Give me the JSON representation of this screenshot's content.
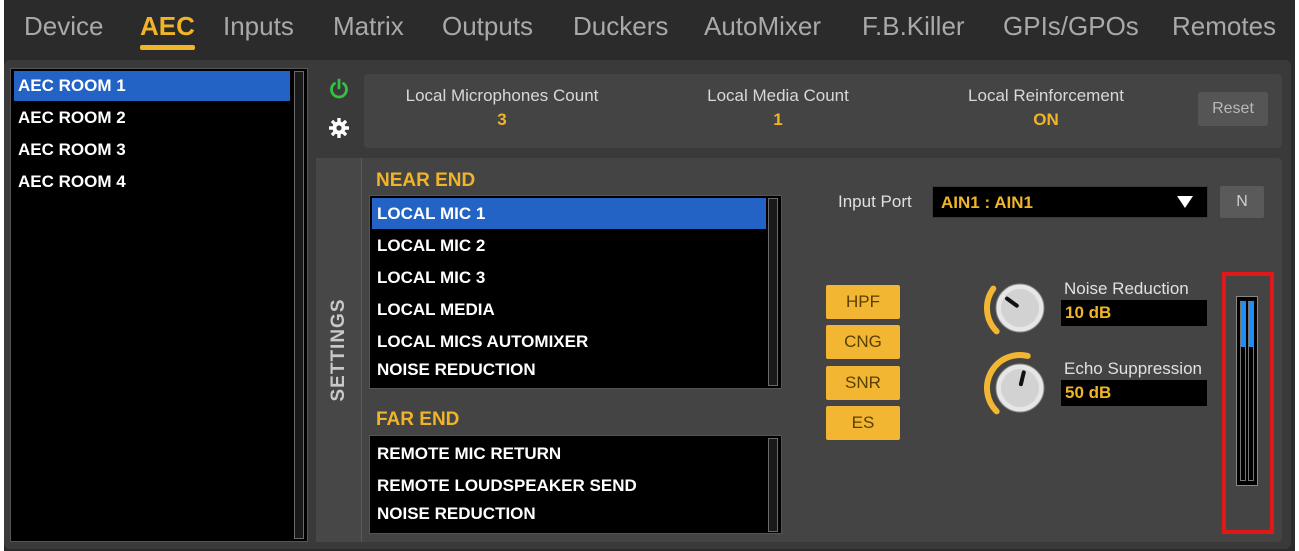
{
  "tabs": [
    {
      "label": "Device",
      "active": false
    },
    {
      "label": "AEC",
      "active": true
    },
    {
      "label": "Inputs",
      "active": false
    },
    {
      "label": "Matrix",
      "active": false
    },
    {
      "label": "Outputs",
      "active": false
    },
    {
      "label": "Duckers",
      "active": false
    },
    {
      "label": "AutoMixer",
      "active": false
    },
    {
      "label": "F.B.Killer",
      "active": false
    },
    {
      "label": "GPIs/GPOs",
      "active": false
    },
    {
      "label": "Remotes",
      "active": false
    }
  ],
  "rooms": {
    "items": [
      "AEC ROOM 1",
      "AEC ROOM 2",
      "AEC ROOM 3",
      "AEC ROOM 4"
    ],
    "selected_index": 0
  },
  "header": {
    "power_icon": "power-icon",
    "gear_icon": "gear-icon",
    "stats": [
      {
        "label": "Local Microphones Count",
        "value": "3"
      },
      {
        "label": "Local Media Count",
        "value": "1"
      },
      {
        "label": "Local Reinforcement",
        "value": "ON"
      }
    ],
    "reset_label": "Reset"
  },
  "settings": {
    "tab_label": "SETTINGS",
    "near_end": {
      "title": "NEAR END",
      "items": [
        "LOCAL MIC 1",
        "LOCAL MIC 2",
        "LOCAL MIC 3",
        "LOCAL MEDIA",
        "LOCAL MICS AUTOMIXER",
        "NOISE REDUCTION"
      ],
      "selected_index": 0
    },
    "far_end": {
      "title": "FAR END",
      "items": [
        "REMOTE MIC RETURN",
        "REMOTE LOUDSPEAKER SEND",
        "NOISE REDUCTION"
      ]
    },
    "input_port": {
      "label": "Input Port",
      "value": "AIN1 : AIN1",
      "n_label": "N"
    },
    "fx_buttons": [
      "HPF",
      "CNG",
      "SNR",
      "ES"
    ],
    "noise_reduction": {
      "label": "Noise Reduction",
      "value": "10 dB",
      "level": 0.3
    },
    "echo_suppression": {
      "label": "Echo Suppression",
      "value": "50 dB",
      "level": 0.55
    },
    "meter": {
      "left_level": 0.25,
      "right_level": 0.25
    }
  },
  "colors": {
    "accent": "#f0b429",
    "selection": "#2463c6",
    "meter_fill": "#1e8ff7",
    "highlight": "#e01818"
  }
}
